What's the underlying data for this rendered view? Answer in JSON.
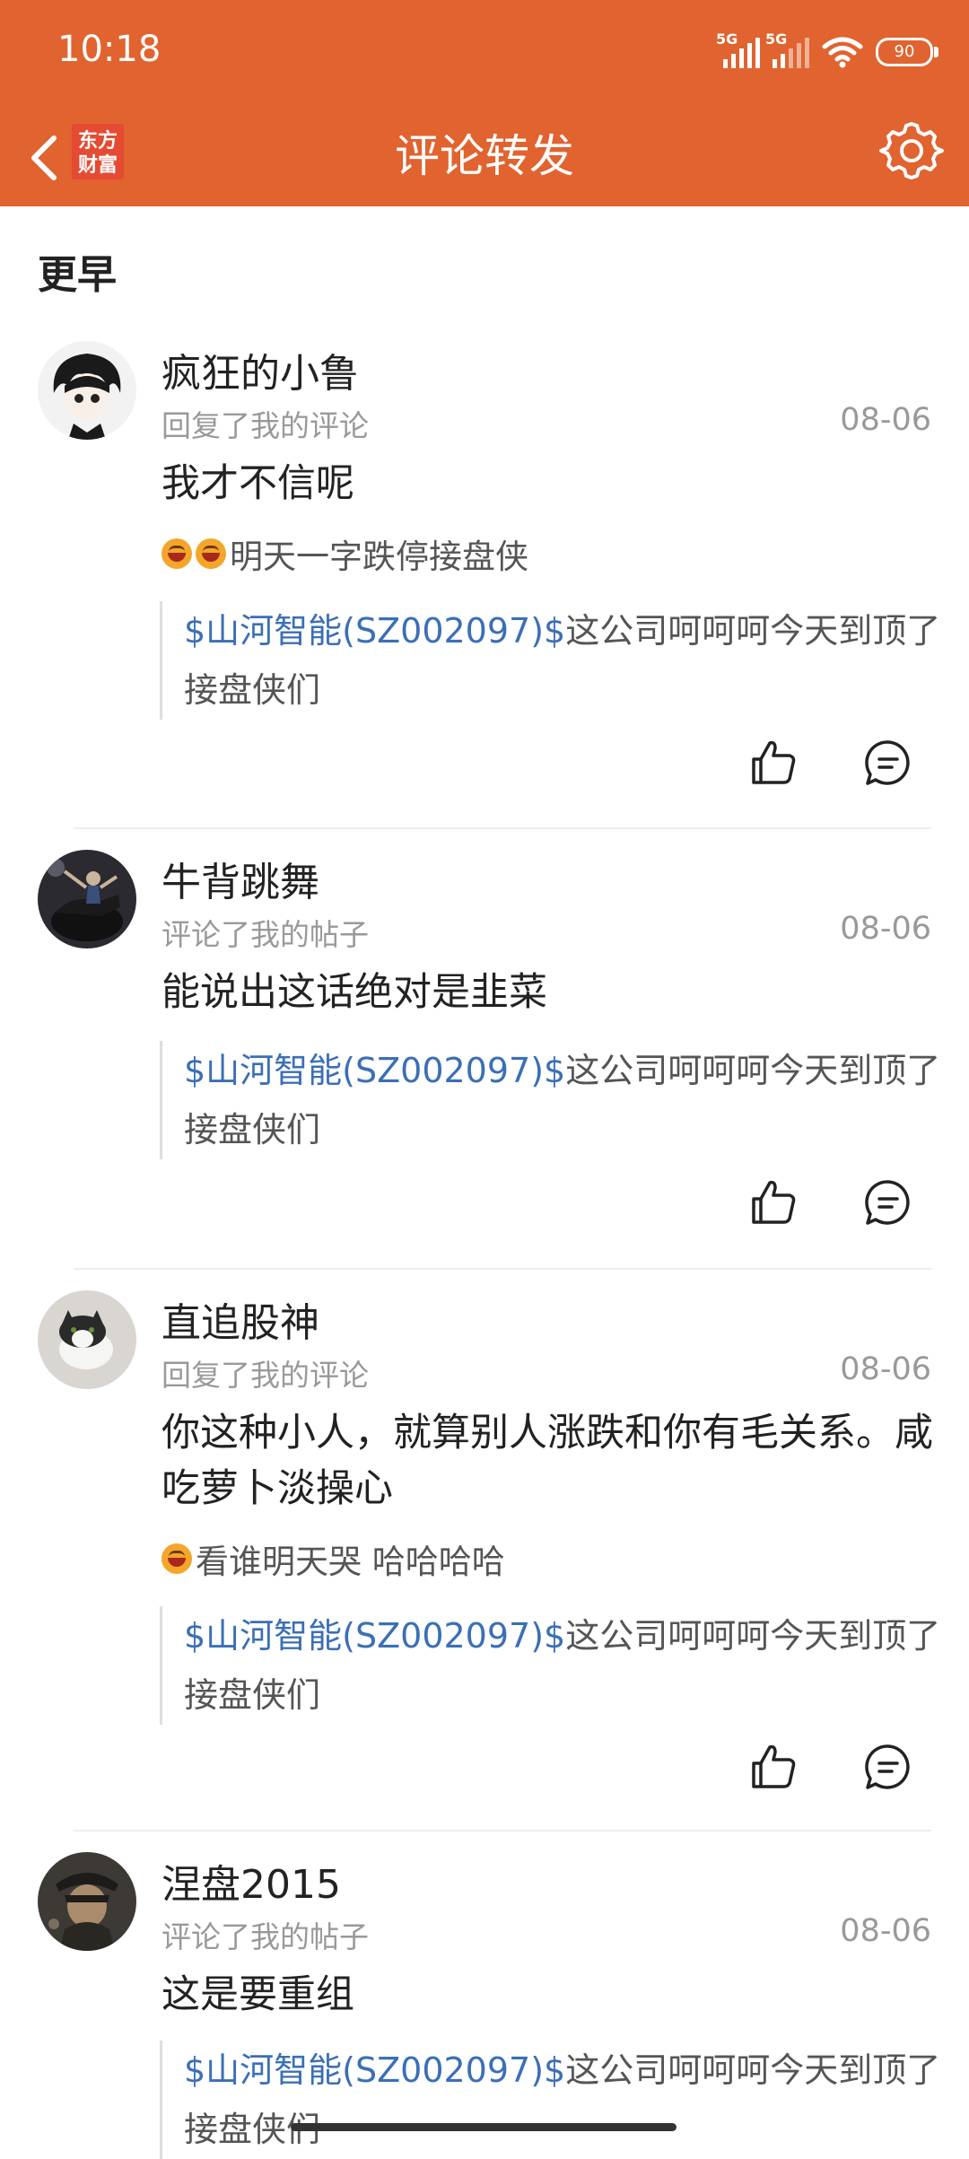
{
  "status_bar": {
    "time": "10:18",
    "signal1_label": "5G",
    "signal2_label": "5G",
    "battery": "90"
  },
  "nav": {
    "title": "评论转发",
    "logo_text_line1": "东方",
    "logo_text_line2": "财富",
    "back_icon": "chevron-left-icon",
    "settings_icon": "gear-icon"
  },
  "section": {
    "title": "更早"
  },
  "colors": {
    "header_bg": "#e1632f",
    "stock_link": "#3b6fb6",
    "meta_text": "#999999"
  },
  "items": [
    {
      "username": "疯狂的小鲁",
      "action": "回复了我的评论",
      "date": "08-06",
      "content": "我才不信呢",
      "sub_emojis": 2,
      "sub_text": "明天一字跌停接盘侠",
      "quote_stock": "$山河智能(SZ002097)$",
      "quote_text": "这公司呵呵呵今天到顶了接盘侠们"
    },
    {
      "username": "牛背跳舞",
      "action": "评论了我的帖子",
      "date": "08-06",
      "content": "能说出这话绝对是韭菜",
      "quote_stock": "$山河智能(SZ002097)$",
      "quote_text": "这公司呵呵呵今天到顶了接盘侠们"
    },
    {
      "username": "直追股神",
      "action": "回复了我的评论",
      "date": "08-06",
      "content": "你这种小人，就算别人涨跌和你有毛关系。咸吃萝卜淡操心",
      "sub_emojis": 1,
      "sub_text": "看谁明天哭 哈哈哈哈",
      "quote_stock": "$山河智能(SZ002097)$",
      "quote_text": "这公司呵呵呵今天到顶了接盘侠们"
    },
    {
      "username": "涅盘2015",
      "action": "评论了我的帖子",
      "date": "08-06",
      "content": "这是要重组",
      "quote_stock": "$山河智能(SZ002097)$",
      "quote_text": "这公司呵呵呵今天到顶了接盘侠们"
    }
  ]
}
